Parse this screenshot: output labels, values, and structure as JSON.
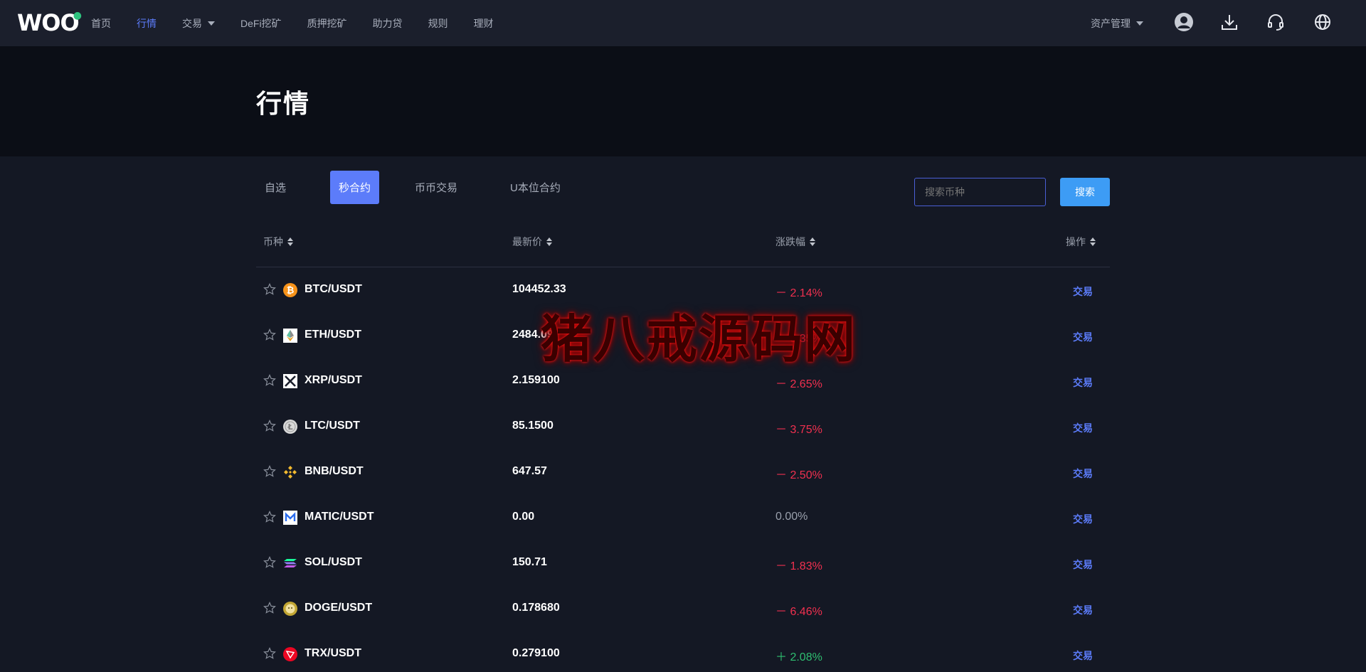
{
  "brand": {
    "logo_text": "WOO"
  },
  "nav": {
    "items": [
      {
        "label": "首页",
        "active": false,
        "caret": false
      },
      {
        "label": "行情",
        "active": true,
        "caret": false
      },
      {
        "label": "交易",
        "active": false,
        "caret": true
      },
      {
        "label": "DeFi挖矿",
        "active": false,
        "caret": false
      },
      {
        "label": "质押挖矿",
        "active": false,
        "caret": false
      },
      {
        "label": "助力贷",
        "active": false,
        "caret": false
      },
      {
        "label": "规则",
        "active": false,
        "caret": false
      },
      {
        "label": "理财",
        "active": false,
        "caret": false
      }
    ],
    "asset_management": "资产管理",
    "icons": [
      "user-icon",
      "download-icon",
      "headset-icon",
      "globe-icon"
    ]
  },
  "page": {
    "title": "行情"
  },
  "tabs": [
    {
      "label": "自选",
      "active": false
    },
    {
      "label": "秒合约",
      "active": true
    },
    {
      "label": "币币交易",
      "active": false
    },
    {
      "label": "U本位合约",
      "active": false
    }
  ],
  "search": {
    "placeholder": "搜索币种",
    "button_label": "搜索"
  },
  "table": {
    "columns": [
      "币种",
      "最新价",
      "涨跌幅",
      "操作"
    ],
    "rows": [
      {
        "pair": "BTC/USDT",
        "icon": "bitcoin-icon",
        "price": "104452.33",
        "change": "－ 2.14%",
        "trend": "down",
        "action": "交易"
      },
      {
        "pair": "ETH/USDT",
        "icon": "ethereum-icon",
        "price": "2484.09",
        "change": "－ 3.35%",
        "trend": "down",
        "action": "交易"
      },
      {
        "pair": "XRP/USDT",
        "icon": "xrp-icon",
        "price": "2.159100",
        "change": "－ 2.65%",
        "trend": "down",
        "action": "交易"
      },
      {
        "pair": "LTC/USDT",
        "icon": "litecoin-icon",
        "price": "85.1500",
        "change": "－ 3.75%",
        "trend": "down",
        "action": "交易"
      },
      {
        "pair": "BNB/USDT",
        "icon": "bnb-icon",
        "price": "647.57",
        "change": "－ 2.50%",
        "trend": "down",
        "action": "交易"
      },
      {
        "pair": "MATIC/USDT",
        "icon": "matic-icon",
        "price": "0.00",
        "change": "0.00%",
        "trend": "flat",
        "action": "交易"
      },
      {
        "pair": "SOL/USDT",
        "icon": "solana-icon",
        "price": "150.71",
        "change": "－ 1.83%",
        "trend": "down",
        "action": "交易"
      },
      {
        "pair": "DOGE/USDT",
        "icon": "dogecoin-icon",
        "price": "0.178680",
        "change": "－ 6.46%",
        "trend": "down",
        "action": "交易"
      },
      {
        "pair": "TRX/USDT",
        "icon": "tron-icon",
        "price": "0.279100",
        "change": "＋ 2.08%",
        "trend": "up",
        "action": "交易"
      }
    ]
  },
  "watermark": {
    "text": "猪八戒源码网"
  },
  "colors": {
    "accent": "#5c7cfa",
    "search_button": "#3d9cf5",
    "down": "#f0304f",
    "up": "#2fbf71",
    "flat": "#9aa0ac"
  }
}
